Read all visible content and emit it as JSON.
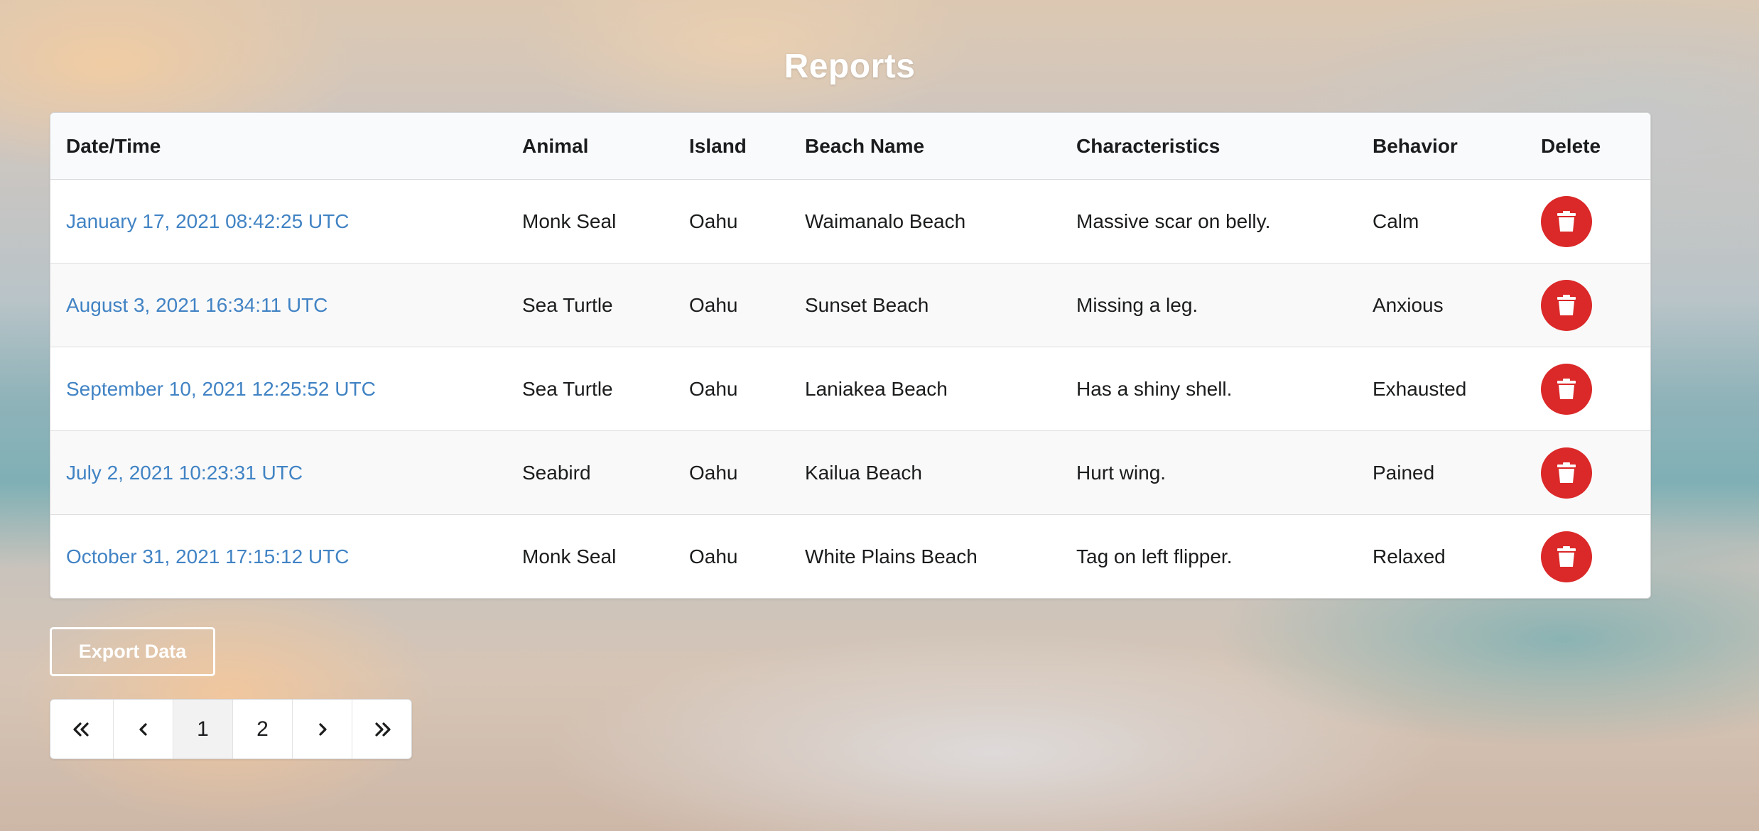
{
  "page": {
    "title": "Reports"
  },
  "table": {
    "columns": [
      "Date/Time",
      "Animal",
      "Island",
      "Beach Name",
      "Characteristics",
      "Behavior",
      "Delete"
    ],
    "rows": [
      {
        "datetime": "January 17, 2021 08:42:25 UTC",
        "animal": "Monk Seal",
        "island": "Oahu",
        "beach": "Waimanalo Beach",
        "characteristics": "Massive scar on belly.",
        "behavior": "Calm"
      },
      {
        "datetime": "August 3, 2021 16:34:11 UTC",
        "animal": "Sea Turtle",
        "island": "Oahu",
        "beach": "Sunset Beach",
        "characteristics": "Missing a leg.",
        "behavior": "Anxious"
      },
      {
        "datetime": "September 10, 2021 12:25:52 UTC",
        "animal": "Sea Turtle",
        "island": "Oahu",
        "beach": "Laniakea Beach",
        "characteristics": "Has a shiny shell.",
        "behavior": "Exhausted"
      },
      {
        "datetime": "July 2, 2021 10:23:31 UTC",
        "animal": "Seabird",
        "island": "Oahu",
        "beach": "Kailua Beach",
        "characteristics": "Hurt wing.",
        "behavior": "Pained"
      },
      {
        "datetime": "October 31, 2021 17:15:12 UTC",
        "animal": "Monk Seal",
        "island": "Oahu",
        "beach": "White Plains Beach",
        "characteristics": "Tag on left flipper.",
        "behavior": "Relaxed"
      }
    ],
    "delete_icon": "trash-icon"
  },
  "export": {
    "label": "Export Data"
  },
  "pagination": {
    "first_icon": "double-chevron-left-icon",
    "prev_icon": "chevron-left-icon",
    "pages": [
      "1",
      "2"
    ],
    "active_page": "1",
    "next_icon": "chevron-right-icon",
    "last_icon": "double-chevron-right-icon"
  },
  "colors": {
    "link": "#4183c4",
    "delete": "#db2828",
    "header_bg": "#f9fafb"
  }
}
